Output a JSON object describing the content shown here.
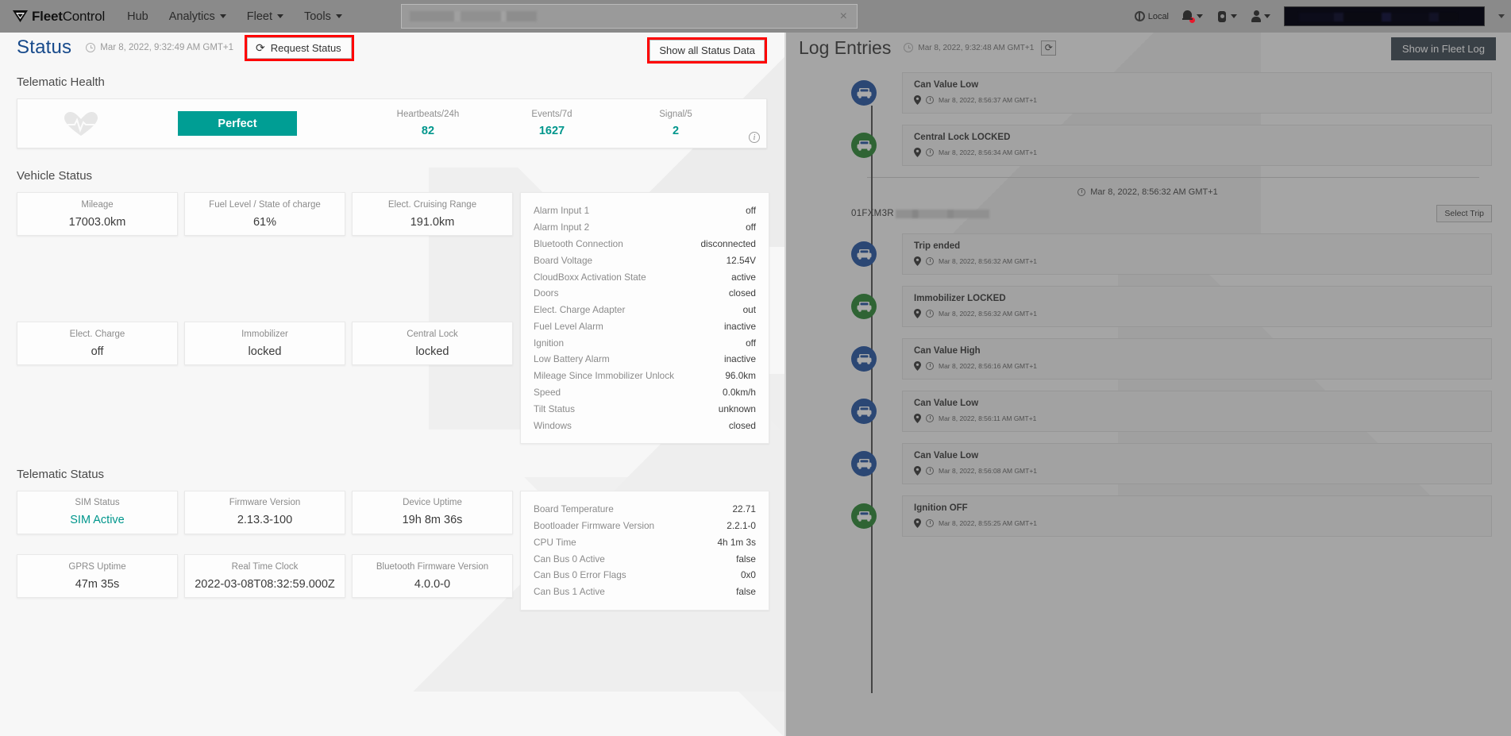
{
  "navbar": {
    "brand_bold": "Fleet",
    "brand_light": "Control",
    "links": [
      {
        "label": "Hub",
        "caret": false
      },
      {
        "label": "Analytics",
        "caret": true
      },
      {
        "label": "Fleet",
        "caret": true
      },
      {
        "label": "Tools",
        "caret": true
      }
    ],
    "search_value": "",
    "search_clear": "×",
    "locale_label": "Local",
    "icons": {
      "globe": "globe-icon",
      "bell": "notification-bell-icon",
      "gear": "settings-gear-icon",
      "user": "user-account-icon"
    }
  },
  "page": {
    "title": "Status",
    "timestamp": "Mar 8, 2022, 9:32:49 AM GMT+1",
    "request_status_label": "Request Status",
    "refresh_glyph": "⟳",
    "show_all_label": "Show all Status Data"
  },
  "telematic_health": {
    "section_title": "Telematic Health",
    "badge": "Perfect",
    "badge_color": "#009e94",
    "metrics": [
      {
        "label": "Heartbeats/24h",
        "value": "82"
      },
      {
        "label": "Events/7d",
        "value": "1627"
      },
      {
        "label": "Signal/5",
        "value": "2"
      }
    ]
  },
  "vehicle_status": {
    "section_title": "Vehicle Status",
    "tiles": [
      {
        "label": "Mileage",
        "value": "17003.0km"
      },
      {
        "label": "Fuel Level / State of charge",
        "value": "61%"
      },
      {
        "label": "Elect. Cruising Range",
        "value": "191.0km"
      },
      {
        "label": "Elect. Charge",
        "value": "off"
      },
      {
        "label": "Immobilizer",
        "value": "locked"
      },
      {
        "label": "Central Lock",
        "value": "locked"
      }
    ],
    "details": [
      {
        "key": "Alarm Input 1",
        "value": "off"
      },
      {
        "key": "Alarm Input 2",
        "value": "off"
      },
      {
        "key": "Bluetooth Connection",
        "value": "disconnected"
      },
      {
        "key": "Board Voltage",
        "value": "12.54V"
      },
      {
        "key": "CloudBoxx Activation State",
        "value": "active"
      },
      {
        "key": "Doors",
        "value": "closed"
      },
      {
        "key": "Elect. Charge Adapter",
        "value": "out"
      },
      {
        "key": "Fuel Level Alarm",
        "value": "inactive"
      },
      {
        "key": "Ignition",
        "value": "off"
      },
      {
        "key": "Low Battery Alarm",
        "value": "inactive"
      },
      {
        "key": "Mileage Since Immobilizer Unlock",
        "value": "96.0km"
      },
      {
        "key": "Speed",
        "value": "0.0km/h"
      },
      {
        "key": "Tilt Status",
        "value": "unknown"
      },
      {
        "key": "Windows",
        "value": "closed"
      }
    ]
  },
  "telematic_status": {
    "section_title": "Telematic Status",
    "tiles": [
      {
        "label": "SIM Status",
        "value": "SIM Active",
        "accent": true
      },
      {
        "label": "Firmware Version",
        "value": "2.13.3-100"
      },
      {
        "label": "Device Uptime",
        "value": "19h 8m 36s"
      },
      {
        "label": "GPRS Uptime",
        "value": "47m 35s"
      },
      {
        "label": "Real Time Clock",
        "value": "2022-03-08T08:32:59.000Z"
      },
      {
        "label": "Bluetooth Firmware Version",
        "value": "4.0.0-0"
      }
    ],
    "details": [
      {
        "key": "Board Temperature",
        "value": "22.71"
      },
      {
        "key": "Bootloader Firmware Version",
        "value": "2.2.1-0"
      },
      {
        "key": "CPU Time",
        "value": "4h 1m 3s"
      },
      {
        "key": "Can Bus 0 Active",
        "value": "false"
      },
      {
        "key": "Can Bus 0 Error Flags",
        "value": "0x0"
      },
      {
        "key": "Can Bus 1 Active",
        "value": "false"
      }
    ]
  },
  "log_panel": {
    "title": "Log Entries",
    "timestamp": "Mar 8, 2022, 9:32:48 AM GMT+1",
    "refresh_glyph": "⟳",
    "fleet_log_label": "Show in Fleet Log",
    "entries_top": [
      {
        "title": "Can Value Low",
        "time": "Mar 8, 2022, 8:56:37 AM GMT+1",
        "icon": "blue"
      },
      {
        "title": "Central Lock LOCKED",
        "time": "Mar 8, 2022, 8:56:34 AM GMT+1",
        "icon": "green"
      }
    ],
    "trip_header_time": "Mar 8, 2022, 8:56:32 AM GMT+1",
    "trip_id_prefix": "01FXM3R",
    "select_trip_label": "Select Trip",
    "entries_trip": [
      {
        "title": "Trip ended",
        "time": "Mar 8, 2022, 8:56:32 AM GMT+1",
        "icon": "blue"
      },
      {
        "title": "Immobilizer LOCKED",
        "time": "Mar 8, 2022, 8:56:32 AM GMT+1",
        "icon": "green"
      },
      {
        "title": "Can Value High",
        "time": "Mar 8, 2022, 8:56:16 AM GMT+1",
        "icon": "blue"
      },
      {
        "title": "Can Value Low",
        "time": "Mar 8, 2022, 8:56:11 AM GMT+1",
        "icon": "blue"
      },
      {
        "title": "Can Value Low",
        "time": "Mar 8, 2022, 8:56:08 AM GMT+1",
        "icon": "blue"
      },
      {
        "title": "Ignition OFF",
        "time": "Mar 8, 2022, 8:55:25 AM GMT+1",
        "icon": "green"
      }
    ]
  }
}
